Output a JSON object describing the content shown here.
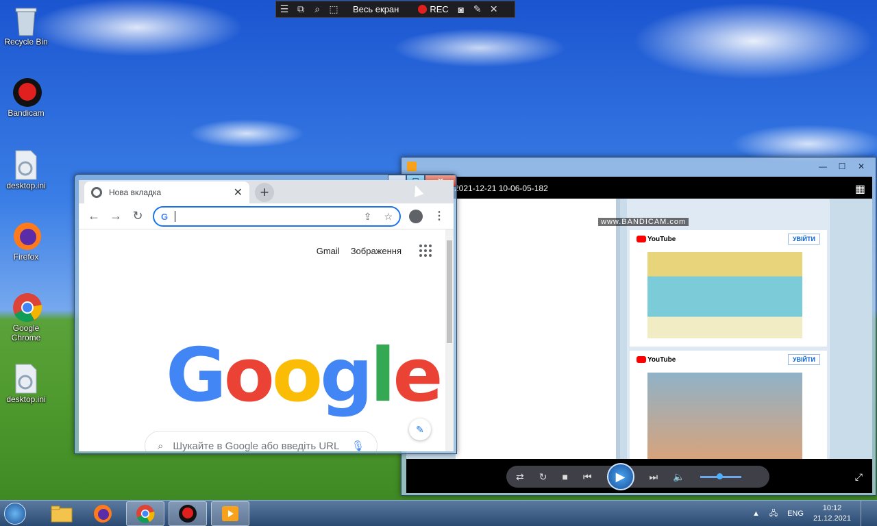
{
  "desktop": {
    "icons": [
      {
        "label": "Recycle Bin",
        "icon": "recycle-bin-icon"
      },
      {
        "label": "Bandicam",
        "icon": "bandicam-icon"
      },
      {
        "label": "desktop.ini",
        "icon": "settings-file-icon"
      },
      {
        "label": "Firefox",
        "icon": "firefox-icon"
      },
      {
        "label": "Google Chrome",
        "icon": "chrome-icon"
      },
      {
        "label": "desktop.ini",
        "icon": "settings-file-icon"
      }
    ]
  },
  "bandicam_bar": {
    "mode_label": "Весь екран",
    "rec_label": "REC"
  },
  "chrome": {
    "tab_title": "Нова вкладка",
    "toplinks": {
      "gmail": "Gmail",
      "images": "Зображення"
    },
    "search_placeholder": "Шукайте в Google або введіть URL",
    "logo_letters": [
      "G",
      "o",
      "o",
      "g",
      "l",
      "e"
    ],
    "logo_colors": [
      "#4285F4",
      "#EA4335",
      "#FBBC05",
      "#4285F4",
      "#34A853",
      "#EA4335"
    ]
  },
  "player": {
    "file_title": "2021-12-21 10-06-05-182",
    "watermark": "www.BANDICAM.com",
    "yt_logo": "YouTube",
    "yt_signin": "УВІЙТИ"
  },
  "taskbar": {
    "lang": "ENG",
    "time": "10:12",
    "date": "21.12.2021"
  }
}
